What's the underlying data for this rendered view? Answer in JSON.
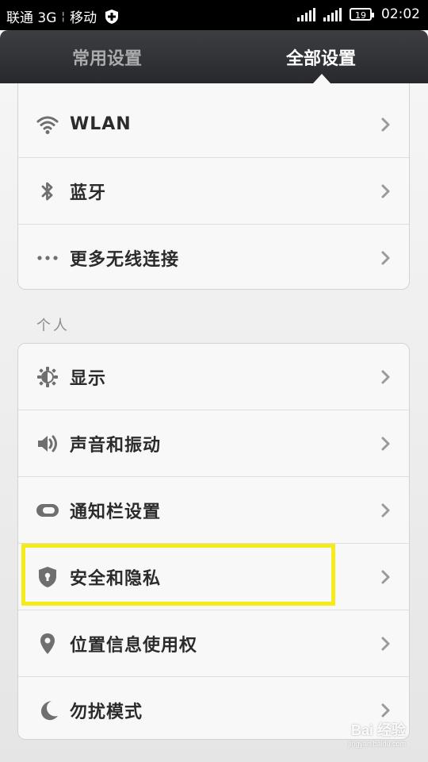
{
  "status_bar": {
    "carrier1": "联通 3G",
    "carrier2": "移动",
    "battery": "19",
    "time": "02:02"
  },
  "tabs": [
    {
      "label": "常用设置",
      "active": false
    },
    {
      "label": "全部设置",
      "active": true
    }
  ],
  "wireless": {
    "items": [
      {
        "label": "WLAN",
        "icon": "wifi-icon"
      },
      {
        "label": "蓝牙",
        "icon": "bluetooth-icon"
      },
      {
        "label": "更多无线连接",
        "icon": "more-dots-icon"
      }
    ]
  },
  "personal": {
    "header": "个人",
    "items": [
      {
        "label": "显示",
        "icon": "brightness-icon"
      },
      {
        "label": "声音和振动",
        "icon": "speaker-icon"
      },
      {
        "label": "通知栏设置",
        "icon": "toggle-icon"
      },
      {
        "label": "安全和隐私",
        "icon": "shield-icon"
      },
      {
        "label": "位置信息使用权",
        "icon": "location-pin-icon"
      },
      {
        "label": "勿扰模式",
        "icon": "moon-icon"
      }
    ]
  },
  "highlight": {
    "target": "安全和隐私",
    "color": "#f5eb18"
  },
  "watermark": {
    "main": "Bai 经验",
    "sub": "jingyan.baidu.com"
  },
  "colors": {
    "tab_active": "#ffffff",
    "tab_inactive": "#a9abad",
    "icon": "#6f6f6f",
    "label": "#2b2b2b"
  }
}
